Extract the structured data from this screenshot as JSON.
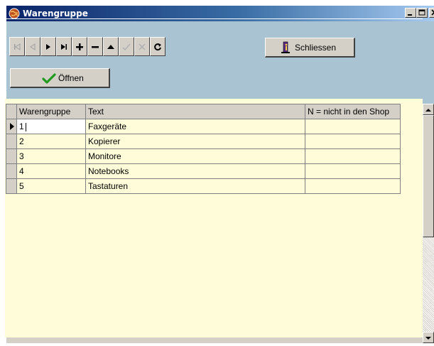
{
  "window": {
    "title": "Warengruppe",
    "colors": {
      "title_gradient_start": "#0a246a",
      "title_gradient_end": "#a6caf0",
      "panel": "#a9c3d3",
      "grid_background": "#fffdd9"
    }
  },
  "navigator": {
    "buttons": [
      {
        "icon": "first-record-icon",
        "enabled": false
      },
      {
        "icon": "prior-record-icon",
        "enabled": false
      },
      {
        "icon": "next-record-icon",
        "enabled": true
      },
      {
        "icon": "last-record-icon",
        "enabled": true
      },
      {
        "icon": "insert-record-icon",
        "enabled": true
      },
      {
        "icon": "delete-record-icon",
        "enabled": true
      },
      {
        "icon": "edit-record-icon",
        "enabled": true
      },
      {
        "icon": "post-record-icon",
        "enabled": false
      },
      {
        "icon": "cancel-edit-icon",
        "enabled": false
      },
      {
        "icon": "refresh-icon",
        "enabled": true
      }
    ]
  },
  "actions": {
    "close_label": "Schliessen",
    "close_icon": "exit-door-icon",
    "open_label": "Öffnen",
    "open_icon": "green-checkmark-icon"
  },
  "grid": {
    "columns": [
      "Warengruppe",
      "Text",
      "N = nicht in den Shop"
    ],
    "rows": [
      {
        "warengruppe": "1",
        "text": "Faxgeräte",
        "shop": ""
      },
      {
        "warengruppe": "2",
        "text": "Kopierer",
        "shop": ""
      },
      {
        "warengruppe": "3",
        "text": "Monitore",
        "shop": ""
      },
      {
        "warengruppe": "4",
        "text": "Notebooks",
        "shop": ""
      },
      {
        "warengruppe": "5",
        "text": "Tastaturen",
        "shop": ""
      }
    ],
    "current_row": 1
  }
}
